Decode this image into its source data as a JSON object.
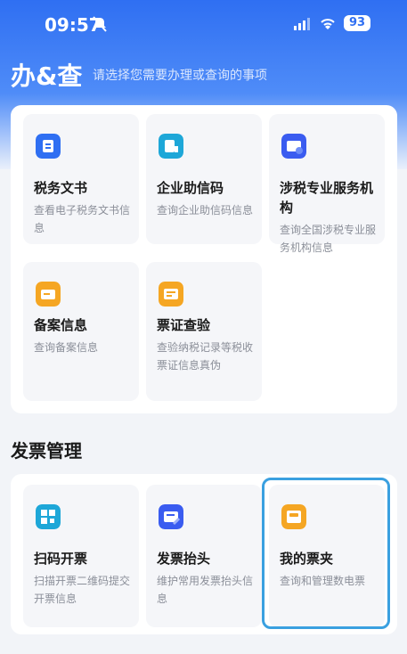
{
  "status": {
    "time": "09:57",
    "battery": "93"
  },
  "header": {
    "title": "办&查",
    "subtitle": "请选择您需要办理或查询的事项"
  },
  "query_items": [
    {
      "name": "税务文书",
      "desc": "查看电子税务文书信息",
      "icon": "document-icon"
    },
    {
      "name": "企业助信码",
      "desc": "查询企业助信码信息",
      "icon": "credit-code-icon"
    },
    {
      "name": "涉税专业服务机构",
      "desc": "查询全国涉税专业服务机构信息",
      "icon": "agency-icon"
    },
    {
      "name": "备案信息",
      "desc": "查询备案信息",
      "icon": "filing-icon"
    },
    {
      "name": "票证查验",
      "desc": "查验纳税记录等税收票证信息真伪",
      "icon": "verify-icon"
    }
  ],
  "invoice_section": {
    "title": "发票管理"
  },
  "invoice_items": [
    {
      "name": "扫码开票",
      "desc": "扫描开票二维码提交开票信息",
      "icon": "qr-code-icon"
    },
    {
      "name": "发票抬头",
      "desc": "维护常用发票抬头信息",
      "icon": "invoice-title-icon"
    },
    {
      "name": "我的票夹",
      "desc": "查询和管理数电票",
      "icon": "wallet-icon"
    }
  ],
  "colors": {
    "primary": "#2f6ff2",
    "orange": "#f5a623",
    "highlight": "#3aa0e0"
  }
}
